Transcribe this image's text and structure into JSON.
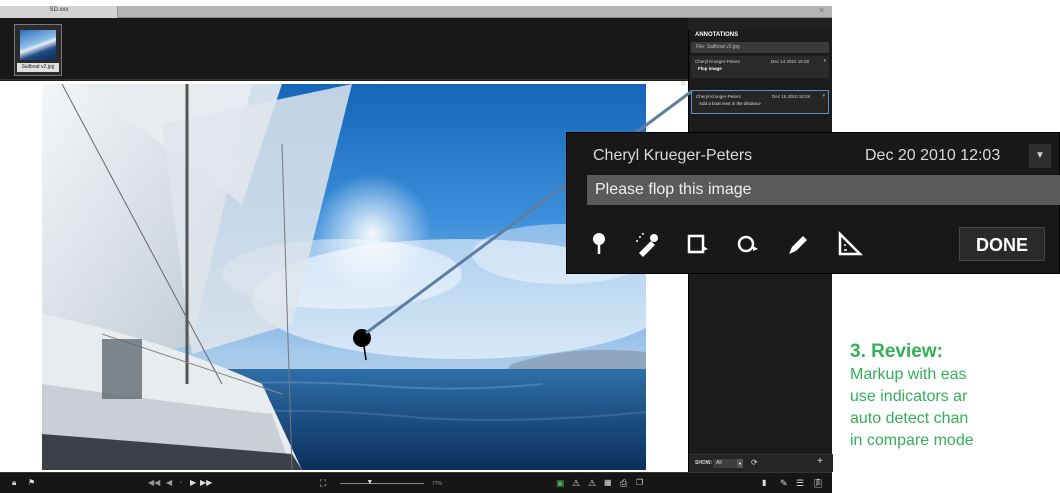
{
  "window": {
    "tab_title": "SD.xxx",
    "close_glyph": "×"
  },
  "filmstrip": {
    "thumb_caption": "Sailboat v2.jpg"
  },
  "annotations": {
    "title": "ANNOTATIONS",
    "file_line": "File: Sailboat v2.jpg",
    "items": [
      {
        "author": "Cheryl Krueger-Peters",
        "date": "Dec 14 2010 16:28",
        "text": "Flop image"
      },
      {
        "author": "Cheryl Krueger-Peters",
        "date": "Dec 15 2010 16:28",
        "text": "Add a boat next in the distance"
      }
    ],
    "show_label": "SHOW:",
    "show_value": "All",
    "add_label": "+",
    "refresh_glyph": "⟳"
  },
  "toolbar": {
    "zoom_percent": "77%",
    "zoom_level": 0.35,
    "left_icons": [
      "lock-icon",
      "flag-icon"
    ],
    "nav_icons": [
      "rewind-icon",
      "previous-icon",
      "dot",
      "next-icon",
      "fast-forward-icon"
    ],
    "right_icons": [
      "info-icon",
      "pencil-icon",
      "notes-icon",
      "clipboard-icon"
    ]
  },
  "callout": {
    "author": "Cheryl Krueger-Peters",
    "date": "Dec 20 2010 12:03",
    "input_value": "Please flop this image",
    "done_label": "DONE",
    "tools": [
      "pin-tool-icon",
      "eyedropper-tool-icon",
      "rectangle-tool-icon",
      "ellipse-tool-icon",
      "pen-tool-icon",
      "measure-tool-icon"
    ]
  },
  "review": {
    "heading": "3. Review:",
    "lines": [
      "Markup with eas",
      "use indicators ar",
      "auto detect chan",
      "in compare mode"
    ]
  },
  "colors": {
    "accent_green": "#33b057",
    "selection_blue": "#5a8fc4",
    "app_bg": "#202020"
  }
}
